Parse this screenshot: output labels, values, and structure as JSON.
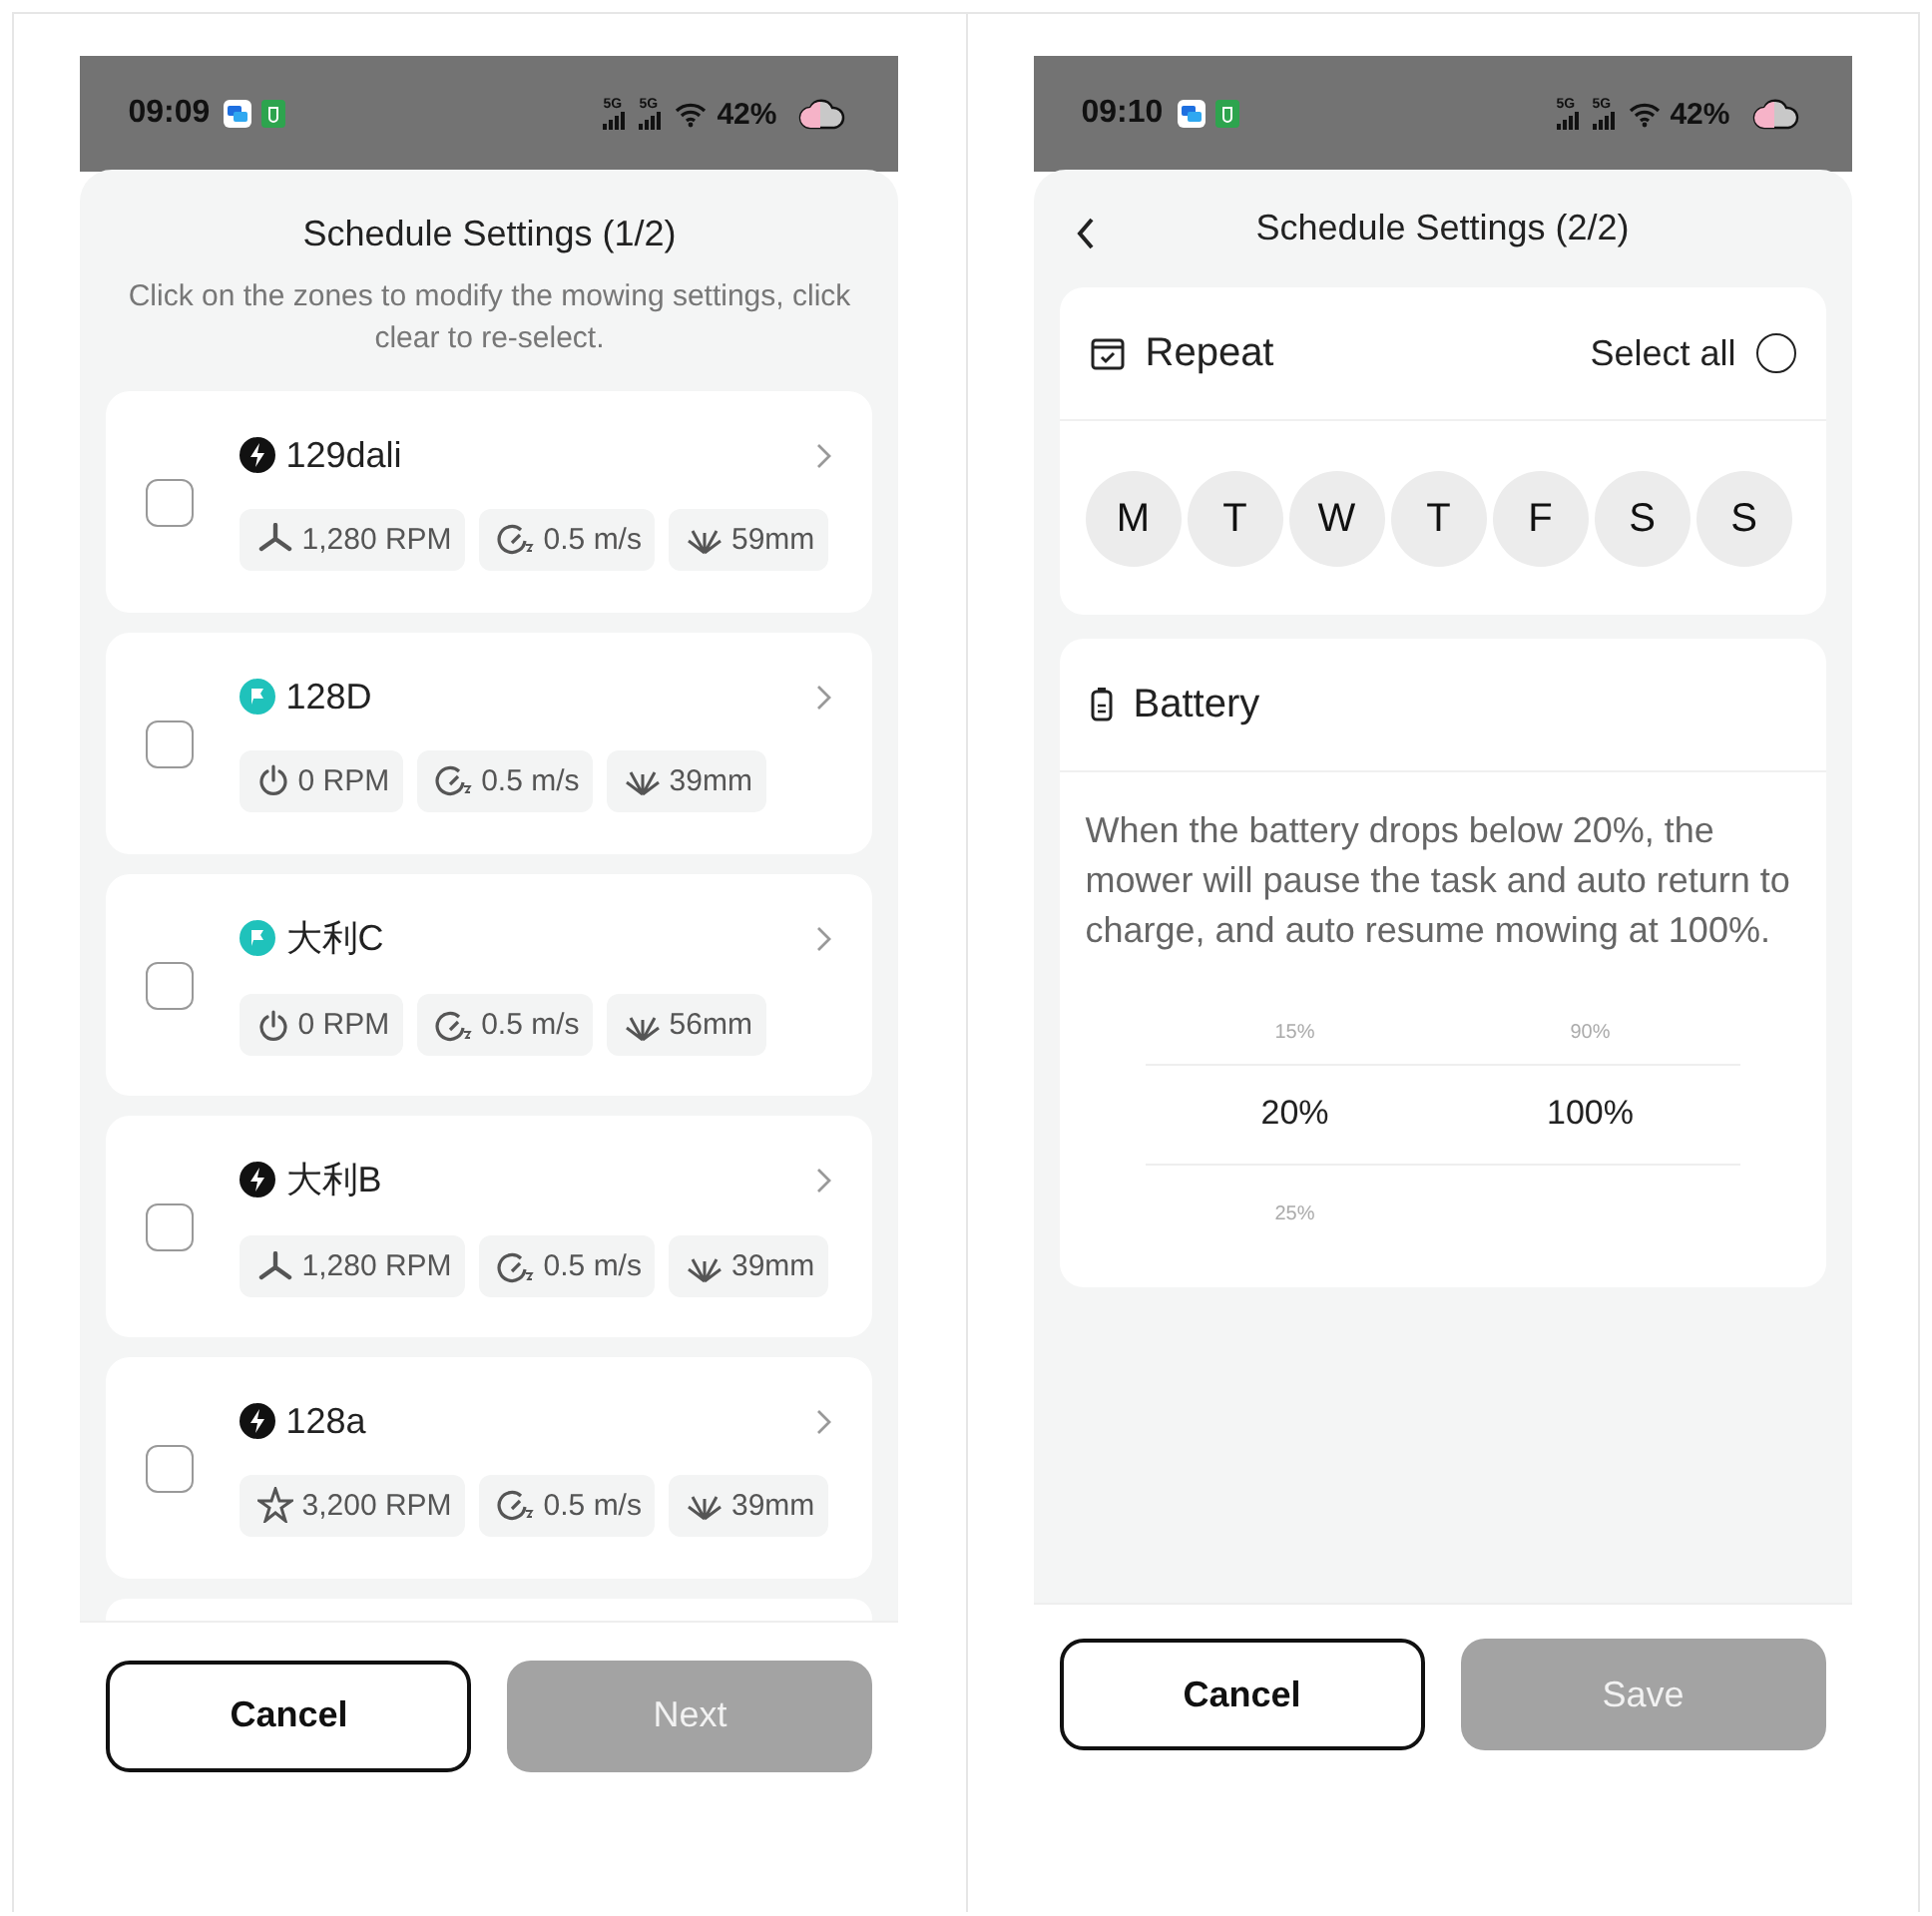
{
  "screen_1": {
    "status_bar": {
      "time": "09:09",
      "network": [
        "5G",
        "5G"
      ],
      "battery": "42%"
    },
    "title": "Schedule Settings (1/2)",
    "subtitle": "Click on the zones to modify the mowing settings, click clear to re-select.",
    "zones": [
      {
        "name": "129dali",
        "kind": "bolt",
        "checked": false,
        "chips": [
          {
            "kind": "blades",
            "text": "1,280 RPM"
          },
          {
            "kind": "speed",
            "text": "0.5 m/s"
          },
          {
            "kind": "height",
            "text": "59mm"
          }
        ]
      },
      {
        "name": "128D",
        "kind": "flag",
        "checked": false,
        "chips": [
          {
            "kind": "power",
            "text": "0 RPM"
          },
          {
            "kind": "speed",
            "text": "0.5 m/s"
          },
          {
            "kind": "height",
            "text": "39mm"
          }
        ]
      },
      {
        "name": "大利C",
        "kind": "flag",
        "checked": false,
        "chips": [
          {
            "kind": "power",
            "text": "0 RPM"
          },
          {
            "kind": "speed",
            "text": "0.5 m/s"
          },
          {
            "kind": "height",
            "text": "56mm"
          }
        ]
      },
      {
        "name": "大利B",
        "kind": "bolt",
        "checked": false,
        "chips": [
          {
            "kind": "blades",
            "text": "1,280 RPM"
          },
          {
            "kind": "speed",
            "text": "0.5 m/s"
          },
          {
            "kind": "height",
            "text": "39mm"
          }
        ]
      },
      {
        "name": "128a",
        "kind": "bolt",
        "checked": false,
        "chips": [
          {
            "kind": "star",
            "text": "3,200 RPM"
          },
          {
            "kind": "speed",
            "text": "0.5 m/s"
          },
          {
            "kind": "height",
            "text": "39mm"
          }
        ]
      }
    ],
    "buttons": [
      {
        "label": "Cancel",
        "kind": "secondary"
      },
      {
        "label": "Next",
        "kind": "disabled"
      }
    ]
  },
  "screen_2": {
    "status_bar": {
      "time": "09:10",
      "network": [
        "5G",
        "5G"
      ],
      "battery": "42%"
    },
    "title": "Schedule Settings (2/2)",
    "repeat": {
      "title": "Repeat",
      "select_all": {
        "label": "Select all",
        "checked": false
      },
      "days": [
        {
          "label": "M",
          "selected": false
        },
        {
          "label": "T",
          "selected": false
        },
        {
          "label": "W",
          "selected": false
        },
        {
          "label": "T",
          "selected": false
        },
        {
          "label": "F",
          "selected": false
        },
        {
          "label": "S",
          "selected": false
        },
        {
          "label": "S",
          "selected": false
        }
      ]
    },
    "battery": {
      "title": "Battery",
      "description": "When the battery drops below 20%, the mower will pause the task and auto return to charge, and auto resume mowing at 100%.",
      "picker": [
        {
          "items": [
            {
              "text": "15%",
              "selected": false
            },
            {
              "text": "20%",
              "selected": true
            },
            {
              "text": "25%",
              "selected": false
            }
          ]
        },
        {
          "items": [
            {
              "text": "90%",
              "selected": false
            },
            {
              "text": "100%",
              "selected": true
            }
          ]
        }
      ]
    },
    "buttons": [
      {
        "label": "Cancel",
        "kind": "secondary"
      },
      {
        "label": "Save",
        "kind": "disabled"
      }
    ]
  }
}
